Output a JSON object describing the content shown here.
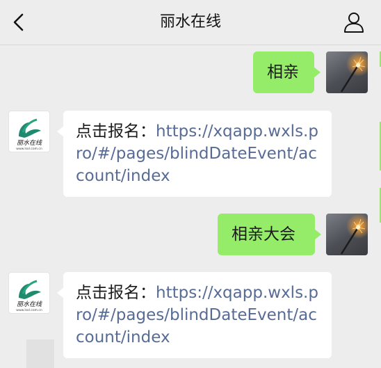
{
  "header": {
    "title": "丽水在线"
  },
  "messages": [
    {
      "side": "right",
      "text": "相亲"
    },
    {
      "side": "left",
      "prefix": "点击报名：",
      "link": "https://xqapp.wxls.pro/#/pages/blindDateEvent/account/index"
    },
    {
      "side": "right",
      "text": "相亲大会"
    },
    {
      "side": "left",
      "prefix": "点击报名：",
      "link": "https://xqapp.wxls.pro/#/pages/blindDateEvent/account/index"
    }
  ],
  "account_logo": {
    "name": "丽水在线",
    "site": "www.lsol.com.cn"
  },
  "colors": {
    "background": "#ededed",
    "bubble_self": "#95ec69",
    "bubble_other": "#ffffff",
    "link": "#576b95"
  },
  "icons": {
    "back": "chevron-left-icon",
    "profile": "person-icon",
    "self_avatar": "sparkler-photo",
    "account_avatar": "crane-logo"
  }
}
